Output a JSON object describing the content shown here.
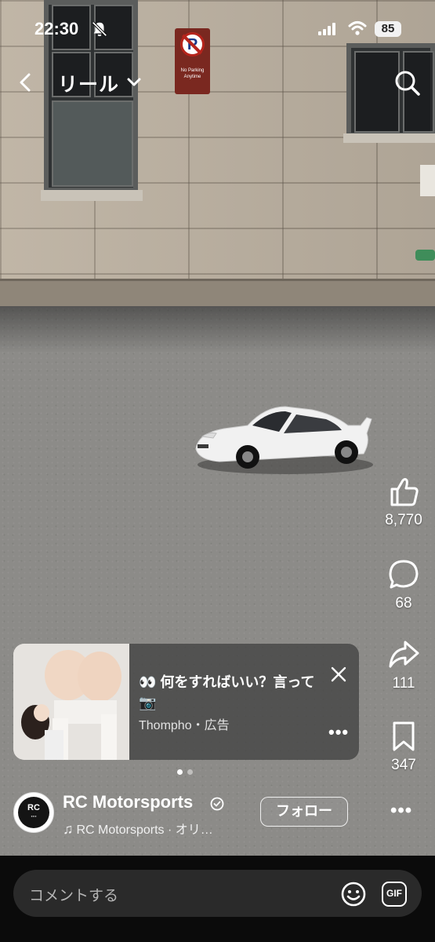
{
  "status_bar": {
    "time": "22:30",
    "battery": "85"
  },
  "header": {
    "title": "リール"
  },
  "scene": {
    "sign_text": "No Parking Anytime"
  },
  "actions": {
    "likes": "8,770",
    "comments": "68",
    "shares": "111",
    "saves": "347"
  },
  "ad": {
    "text": "👀 何をすればいい？言って📷",
    "sponsor": "Thompho・広告",
    "more": "•••"
  },
  "author": {
    "avatar_text": "RC",
    "name": "RC Motorsports",
    "audio": "RC Motorsports · オリ…",
    "follow_label": "フォロー",
    "more": "•••"
  },
  "comment": {
    "placeholder": "コメントする",
    "gif_label": "GIF"
  },
  "colors": {
    "accent": "#ffffff",
    "background": "#000000",
    "comment_bg": "#2a2a2a"
  }
}
